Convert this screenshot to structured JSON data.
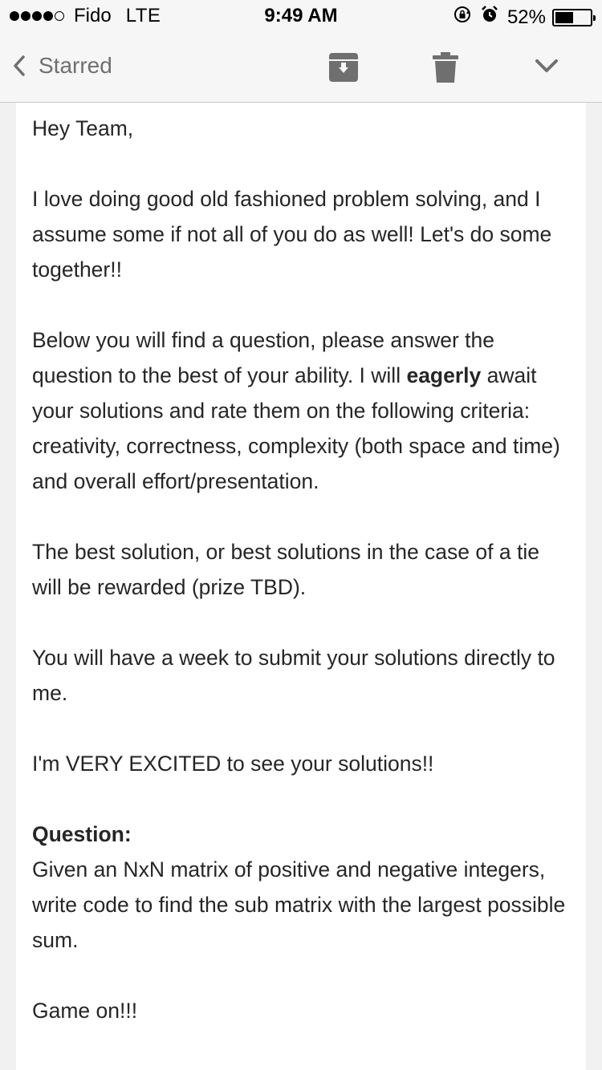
{
  "status_bar": {
    "carrier": "Fido",
    "network": "LTE",
    "time": "9:49 AM",
    "battery_percent": "52%",
    "battery_level": 0.52,
    "signal_bars": 4,
    "signal_total": 5,
    "icons": [
      "rotation-lock-icon",
      "alarm-icon"
    ]
  },
  "toolbar": {
    "back_label": "Starred",
    "icons": [
      "back-chevron-icon",
      "archive-icon",
      "trash-icon",
      "chevron-down-icon"
    ]
  },
  "email": {
    "greeting": "Hey Team,",
    "p1": "I love doing good old fashioned problem solving, and I assume some if not all of you do as well! Let's do some together!!",
    "p2_before": "Below you will find a question, please answer the question to the best of your ability. I will ",
    "p2_bold": "eagerly",
    "p2_after": " await your solutions and rate them on the following criteria: creativity, correctness, complexity (both space and time) and overall effort/presentation.",
    "p3": "The best solution, or best solutions in the case of a tie will be rewarded (prize TBD).",
    "p4": "You will have a week to submit your solutions directly to me.",
    "p5": "I'm VERY EXCITED to see your solutions!!",
    "question_heading": "Question:",
    "question_body": "Given an NxN matrix of positive and negative integers, write code to find the sub matrix with the largest possible sum.",
    "closing": "Game on!!!"
  },
  "colors": {
    "background": "#f1f1f1",
    "bar": "#f6f6f6",
    "icon_gray": "#6f6f6f",
    "text": "#262626"
  }
}
